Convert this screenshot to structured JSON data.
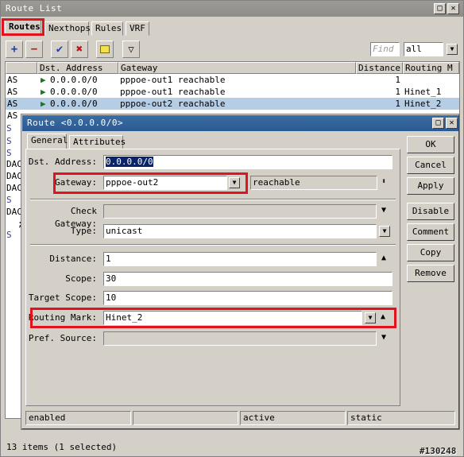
{
  "window": {
    "title": "Route List",
    "min_icon": "□",
    "close_icon": "✕"
  },
  "tabs": [
    "Routes",
    "Nexthops",
    "Rules",
    "VRF"
  ],
  "toolbar": {
    "find_placeholder": "Find",
    "filter_value": "all"
  },
  "columns": [
    "",
    "Dst. Address",
    "Gateway",
    "Distance",
    "Routing M"
  ],
  "rows": [
    {
      "flag": "AS",
      "dst": "0.0.0.0/0",
      "gateway": "pppoe-out1 reachable",
      "distance": "1",
      "mark": ""
    },
    {
      "flag": "AS",
      "dst": "0.0.0.0/0",
      "gateway": "pppoe-out1 reachable",
      "distance": "1",
      "mark": "Hinet_1"
    },
    {
      "flag": "AS",
      "dst": "0.0.0.0/0",
      "gateway": "pppoe-out2 reachable",
      "distance": "1",
      "mark": "Hinet_2"
    },
    {
      "flag": "AS",
      "dst": "",
      "gateway": "",
      "distance": "",
      "mark": ""
    }
  ],
  "side_flags": [
    "S",
    "S",
    "S",
    "DAC",
    "DAC",
    "DAC",
    "S",
    "DAC",
    ";",
    "S"
  ],
  "status": {
    "items": "13 items (1 selected)"
  },
  "watermark": "#130248",
  "dialog": {
    "title": "Route <0.0.0.0/0>",
    "tabs": [
      "General",
      "Attributes"
    ],
    "fields": {
      "dst_label": "Dst. Address:",
      "dst_value": "0.0.0.0/0",
      "gateway_label": "Gateway:",
      "gateway_value": "pppoe-out2",
      "gateway_state": "reachable",
      "check_label": "Check Gateway:",
      "check_value": "",
      "type_label": "Type:",
      "type_value": "unicast",
      "distance_label": "Distance:",
      "distance_value": "1",
      "scope_label": "Scope:",
      "scope_value": "30",
      "target_label": "Target Scope:",
      "target_value": "10",
      "mark_label": "Routing Mark:",
      "mark_value": "Hinet_2",
      "pref_label": "Pref. Source:",
      "pref_value": ""
    },
    "buttons": [
      "OK",
      "Cancel",
      "Apply",
      "Disable",
      "Comment",
      "Copy",
      "Remove"
    ],
    "status": [
      "enabled",
      "",
      "active",
      "static"
    ]
  }
}
